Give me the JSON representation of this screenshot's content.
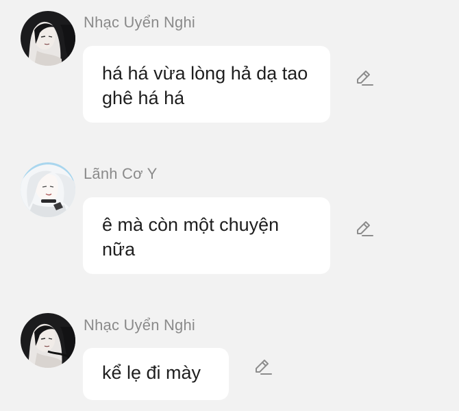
{
  "messages": [
    {
      "sender": "Nhạc Uyển Nghi",
      "text": "há há vừa lòng hả dạ tao ghê há há",
      "avatar": "avatar-dark-hair"
    },
    {
      "sender": "Lãnh Cơ Y",
      "text": "ê mà còn một chuyện nữa",
      "avatar": "avatar-white-hair"
    },
    {
      "sender": "Nhạc Uyển Nghi",
      "text": "kể lẹ đi mày",
      "avatar": "avatar-dark-hair"
    }
  ],
  "icons": {
    "edit": "pencil-edit-icon"
  },
  "colors": {
    "background": "#f2f2f2",
    "bubble": "#ffffff",
    "sender_name": "#8a8a8a",
    "message_text": "#1e1e1e",
    "icon": "#8c8c8c"
  }
}
